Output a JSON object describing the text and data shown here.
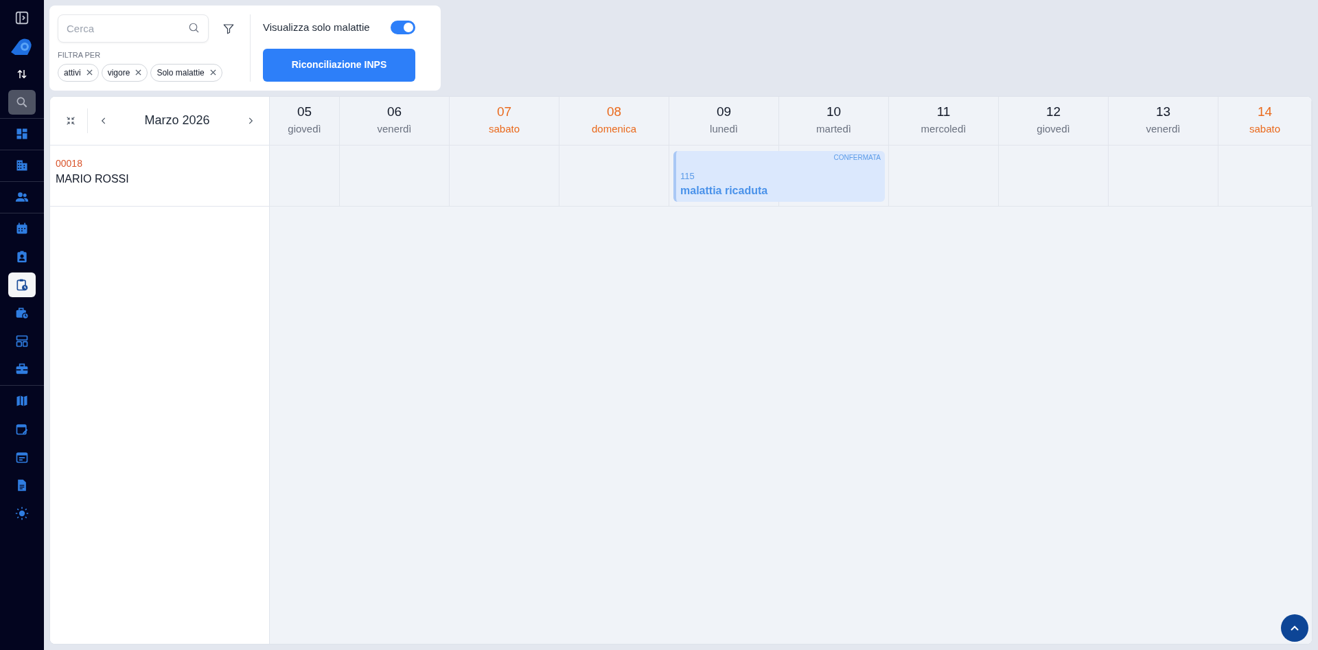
{
  "sidebar": {
    "items": [
      {
        "kind": "panel-toggle",
        "selected": false
      },
      {
        "kind": "logo",
        "selected": false
      },
      {
        "kind": "switch",
        "selected": false
      },
      {
        "kind": "search",
        "selected": true
      },
      {
        "kind": "divider"
      },
      {
        "kind": "dashboard",
        "selected": false
      },
      {
        "kind": "divider"
      },
      {
        "kind": "building",
        "selected": false
      },
      {
        "kind": "divider"
      },
      {
        "kind": "people",
        "selected": false
      },
      {
        "kind": "divider"
      },
      {
        "kind": "calendar",
        "selected": false
      },
      {
        "kind": "badge",
        "selected": false
      },
      {
        "kind": "clipboard-clock",
        "selected": true
      },
      {
        "kind": "briefcase-clock",
        "selected": false
      },
      {
        "kind": "layout",
        "selected": false
      },
      {
        "kind": "toolbox",
        "selected": false
      },
      {
        "kind": "divider"
      },
      {
        "kind": "map",
        "selected": false
      },
      {
        "kind": "calendar-edit",
        "selected": false
      },
      {
        "kind": "calendar-notes",
        "selected": false
      },
      {
        "kind": "document",
        "selected": false
      },
      {
        "kind": "sun",
        "selected": false
      }
    ]
  },
  "filters": {
    "search": {
      "placeholder": "Cerca"
    },
    "filter_label": "FILTRA PER",
    "chips": [
      {
        "label": "attivi"
      },
      {
        "label": "vigore"
      },
      {
        "label": "Solo malattie"
      }
    ],
    "toggle": {
      "label": "Visualizza solo malattie",
      "on": true
    },
    "button": "Riconciliazione INPS"
  },
  "calendar": {
    "month": "Marzo 2026",
    "days": [
      {
        "date": "05",
        "weekday": "giovedì",
        "weekend": false
      },
      {
        "date": "06",
        "weekday": "venerdì",
        "weekend": false
      },
      {
        "date": "07",
        "weekday": "sabato",
        "weekend": true
      },
      {
        "date": "08",
        "weekday": "domenica",
        "weekend": true
      },
      {
        "date": "09",
        "weekday": "lunedì",
        "weekend": false
      },
      {
        "date": "10",
        "weekday": "martedì",
        "weekend": false
      },
      {
        "date": "11",
        "weekday": "mercoledì",
        "weekend": false
      },
      {
        "date": "12",
        "weekday": "giovedì",
        "weekend": false
      },
      {
        "date": "13",
        "weekday": "venerdì",
        "weekend": false
      },
      {
        "date": "14",
        "weekday": "sabato",
        "weekend": true
      }
    ],
    "employees": [
      {
        "code": "00018",
        "name": "MARIO ROSSI",
        "days": [
          {
            "absent": false
          },
          {
            "absent": false
          },
          {
            "absent": false
          },
          {
            "absent": false
          },
          {
            "absent": true,
            "status": "CONFERMATA",
            "number": "115",
            "title": "malattia ricaduta"
          },
          {
            "absent": true
          },
          {
            "absent": false
          },
          {
            "absent": false
          },
          {
            "absent": false
          },
          {
            "absent": false
          }
        ]
      }
    ]
  }
}
